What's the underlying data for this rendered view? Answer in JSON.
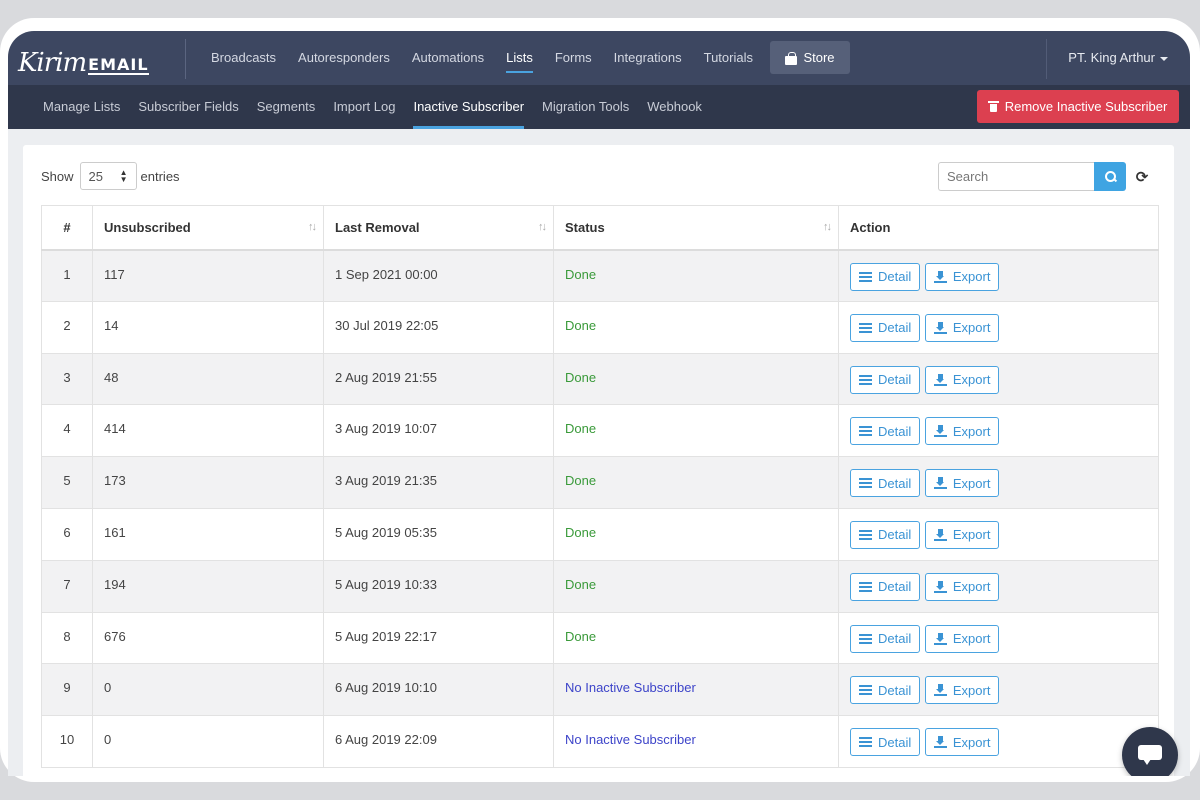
{
  "brand": {
    "script": "Kirim",
    "mail": "EMAIL"
  },
  "nav": {
    "items": [
      {
        "label": "Broadcasts",
        "name": "nav-broadcasts",
        "active": false
      },
      {
        "label": "Autoresponders",
        "name": "nav-autoresponders",
        "active": false
      },
      {
        "label": "Automations",
        "name": "nav-automations",
        "active": false
      },
      {
        "label": "Lists",
        "name": "nav-lists",
        "active": true
      },
      {
        "label": "Forms",
        "name": "nav-forms",
        "active": false
      },
      {
        "label": "Integrations",
        "name": "nav-integrations",
        "active": false
      },
      {
        "label": "Tutorials",
        "name": "nav-tutorials",
        "active": false
      }
    ],
    "store_label": "Store",
    "user_label": "PT. King Arthur"
  },
  "subnav": {
    "items": [
      {
        "label": "Manage Lists",
        "name": "subnav-manage-lists",
        "active": false
      },
      {
        "label": "Subscriber Fields",
        "name": "subnav-subscriber-fields",
        "active": false
      },
      {
        "label": "Segments",
        "name": "subnav-segments",
        "active": false
      },
      {
        "label": "Import Log",
        "name": "subnav-import-log",
        "active": false
      },
      {
        "label": "Inactive Subscriber",
        "name": "subnav-inactive-subscriber",
        "active": true
      },
      {
        "label": "Migration Tools",
        "name": "subnav-migration-tools",
        "active": false
      },
      {
        "label": "Webhook",
        "name": "subnav-webhook",
        "active": false
      }
    ],
    "remove_label": "Remove Inactive Subscriber"
  },
  "controls": {
    "show_label": "Show",
    "entries_value": "25",
    "entries_label": "entries",
    "search_placeholder": "Search"
  },
  "table": {
    "headers": {
      "num": "#",
      "unsubscribed": "Unsubscribed",
      "last_removal": "Last Removal",
      "status": "Status",
      "action": "Action"
    },
    "detail_label": "Detail",
    "export_label": "Export",
    "rows": [
      {
        "num": "1",
        "unsubscribed": "117",
        "last_removal": "1 Sep 2021 00:00",
        "status": "Done"
      },
      {
        "num": "2",
        "unsubscribed": "14",
        "last_removal": "30 Jul 2019 22:05",
        "status": "Done"
      },
      {
        "num": "3",
        "unsubscribed": "48",
        "last_removal": "2 Aug 2019 21:55",
        "status": "Done"
      },
      {
        "num": "4",
        "unsubscribed": "414",
        "last_removal": "3 Aug 2019 10:07",
        "status": "Done"
      },
      {
        "num": "5",
        "unsubscribed": "173",
        "last_removal": "3 Aug 2019 21:35",
        "status": "Done"
      },
      {
        "num": "6",
        "unsubscribed": "161",
        "last_removal": "5 Aug 2019 05:35",
        "status": "Done"
      },
      {
        "num": "7",
        "unsubscribed": "194",
        "last_removal": "5 Aug 2019 10:33",
        "status": "Done"
      },
      {
        "num": "8",
        "unsubscribed": "676",
        "last_removal": "5 Aug 2019 22:17",
        "status": "Done"
      },
      {
        "num": "9",
        "unsubscribed": "0",
        "last_removal": "6 Aug 2019 10:10",
        "status": "No Inactive Subscriber"
      },
      {
        "num": "10",
        "unsubscribed": "0",
        "last_removal": "6 Aug 2019 22:09",
        "status": "No Inactive Subscriber"
      }
    ]
  },
  "colors": {
    "topbar": "#3d4761",
    "subbar": "#2f374b",
    "accent": "#4aa3e0",
    "danger": "#dc4050",
    "status_done": "#3a9a3a",
    "status_none": "#3d44c9"
  }
}
